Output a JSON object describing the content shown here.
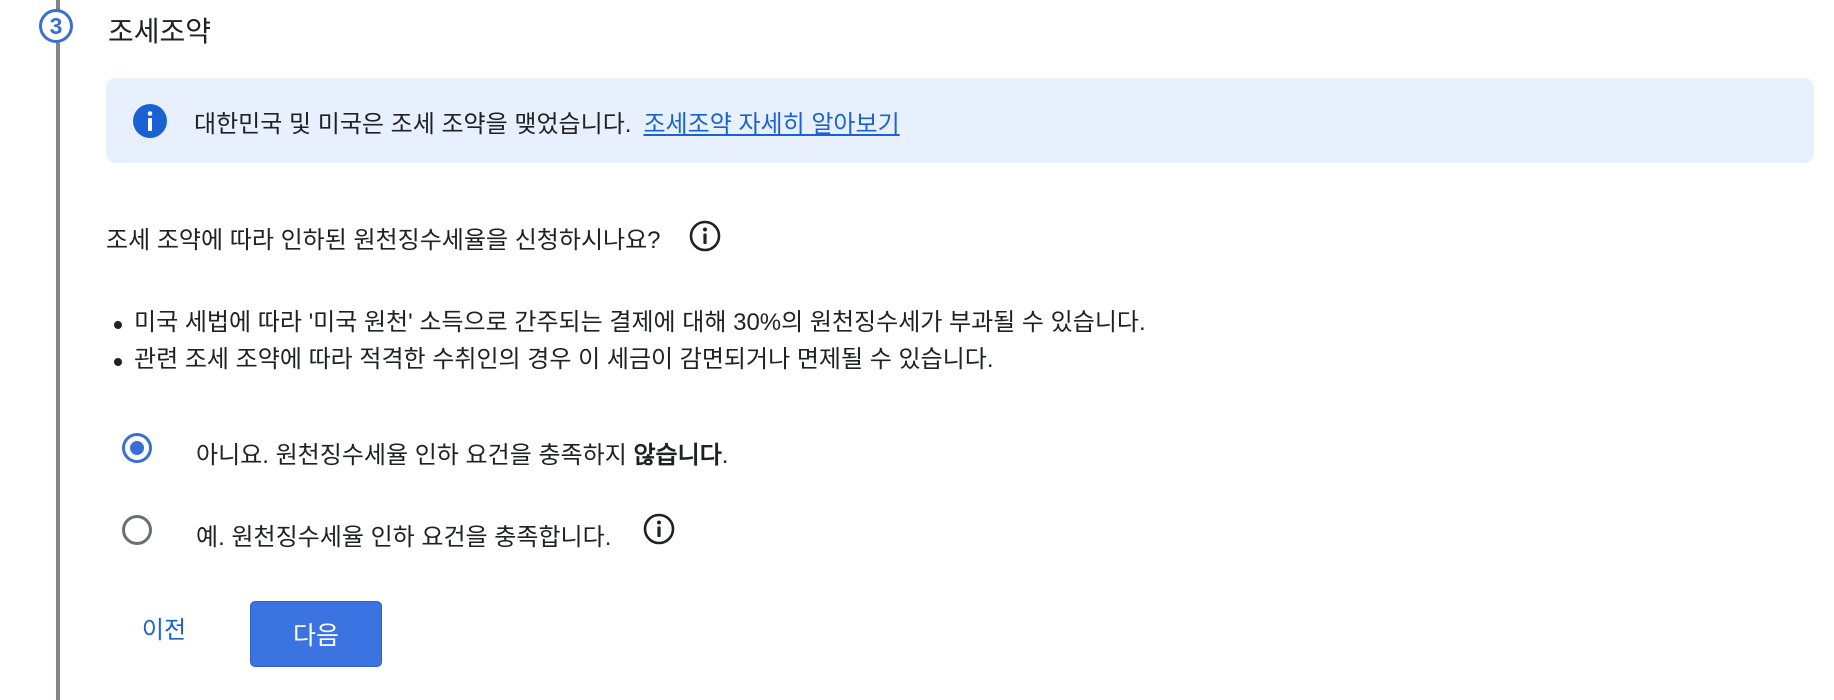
{
  "step": {
    "number": "3",
    "title": "조세조약"
  },
  "banner": {
    "icon": "info-icon",
    "text": "대한민국 및 미국은 조세 조약을 맺었습니다.",
    "link": "조세조약 자세히 알아보기",
    "background": "#e8f0fd",
    "icon_color": "#1a62d2"
  },
  "question": {
    "text": "조세 조약에 따라 인하된 원천징수세율을 신청하시나요?",
    "icon": "info-outline-icon"
  },
  "bullets": [
    "미국 세법에 따라 '미국 원천' 소득으로 간주되는 결제에 대해 30%의 원천징수세가 부과될 수 있습니다.",
    "관련 조세 조약에 따라 적격한 수취인의 경우 이 세금이 감면되거나 면제될 수 있습니다."
  ],
  "options": {
    "no": {
      "prefix": "아니요. 원천징수세율 인하 요건을 충족하지 ",
      "bold": "않습니다",
      "suffix": ".",
      "selected": true
    },
    "yes": {
      "text": "예. 원천징수세율 인하 요건을 충족합니다.",
      "selected": false,
      "icon": "info-outline-icon"
    }
  },
  "buttons": {
    "prev": "이전",
    "next": "다음"
  },
  "colors": {
    "accent": "#3b6fd4",
    "primary_button": "#3b74e0",
    "link": "#1a62d2",
    "rail": "#80868b"
  }
}
